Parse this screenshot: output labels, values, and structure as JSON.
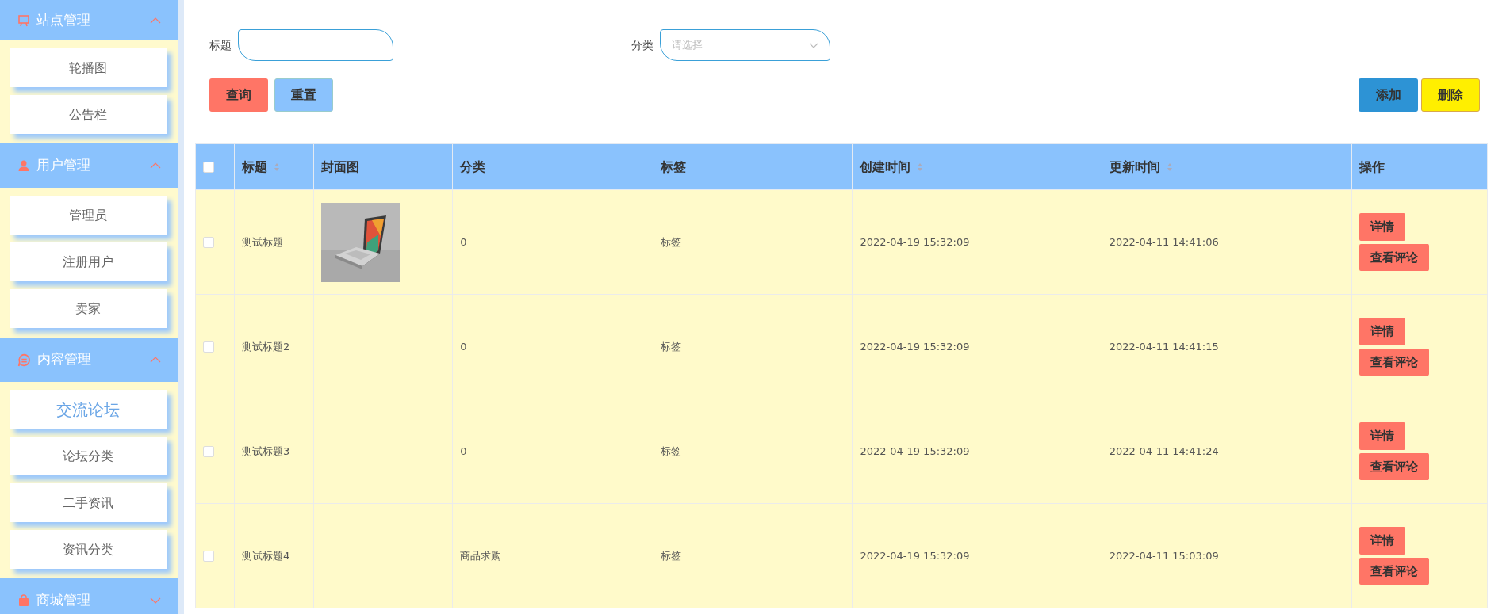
{
  "sidebar": {
    "groups": [
      {
        "title": "站点管理",
        "expanded": true,
        "items": [
          {
            "label": "轮播图",
            "selected": false
          },
          {
            "label": "公告栏",
            "selected": false
          }
        ]
      },
      {
        "title": "用户管理",
        "expanded": true,
        "items": [
          {
            "label": "管理员",
            "selected": false
          },
          {
            "label": "注册用户",
            "selected": false
          },
          {
            "label": "卖家",
            "selected": false
          }
        ]
      },
      {
        "title": "内容管理",
        "expanded": true,
        "items": [
          {
            "label": "交流论坛",
            "selected": true
          },
          {
            "label": "论坛分类",
            "selected": false
          },
          {
            "label": "二手资讯",
            "selected": false
          },
          {
            "label": "资讯分类",
            "selected": false
          }
        ]
      },
      {
        "title": "商城管理",
        "expanded": false
      }
    ]
  },
  "search": {
    "fields": [
      {
        "label": "标题",
        "kind": "text"
      },
      {
        "label": "分类",
        "kind": "select",
        "placeholder": "请选择"
      }
    ],
    "buttons": [
      {
        "label": "查询",
        "kind": "query"
      },
      {
        "label": "重置",
        "kind": "reset"
      }
    ]
  },
  "toolbar": {
    "buttons": [
      {
        "label": "添加",
        "kind": "add"
      },
      {
        "label": "删除",
        "kind": "delete"
      }
    ]
  },
  "table": {
    "select_all": {
      "checked": false
    },
    "columns": [
      {
        "label": "标题",
        "sortable": true
      },
      {
        "label": "封面图",
        "sortable": false
      },
      {
        "label": "分类",
        "sortable": false
      },
      {
        "label": "标签",
        "sortable": false
      },
      {
        "label": "创建时间",
        "sortable": true
      },
      {
        "label": "更新时间",
        "sortable": true
      },
      {
        "label": "操作",
        "sortable": false
      }
    ],
    "rows": [
      {
        "checked": false,
        "title": "测试标题",
        "cover": {
          "kind": "picture"
        },
        "category": "0",
        "tag": "标签",
        "created": "2022-04-19 15:32:09",
        "updated": "2022-04-11 14:41:06",
        "actions": [
          "详情",
          "查看评论"
        ]
      },
      {
        "checked": false,
        "title": "测试标题2",
        "category": "0",
        "tag": "标签",
        "created": "2022-04-19 15:32:09",
        "updated": "2022-04-11 14:41:15",
        "actions": [
          "详情",
          "查看评论"
        ]
      },
      {
        "checked": false,
        "title": "测试标题3",
        "category": "0",
        "tag": "标签",
        "created": "2022-04-19 15:32:09",
        "updated": "2022-04-11 14:41:24",
        "actions": [
          "详情",
          "查看评论"
        ]
      },
      {
        "checked": false,
        "title": "测试标题4",
        "category": "商品求购",
        "tag": "标签",
        "created": "2022-04-19 15:32:09",
        "updated": "2022-04-11 15:03:09",
        "actions": [
          "详情",
          "查看评论"
        ]
      }
    ]
  }
}
